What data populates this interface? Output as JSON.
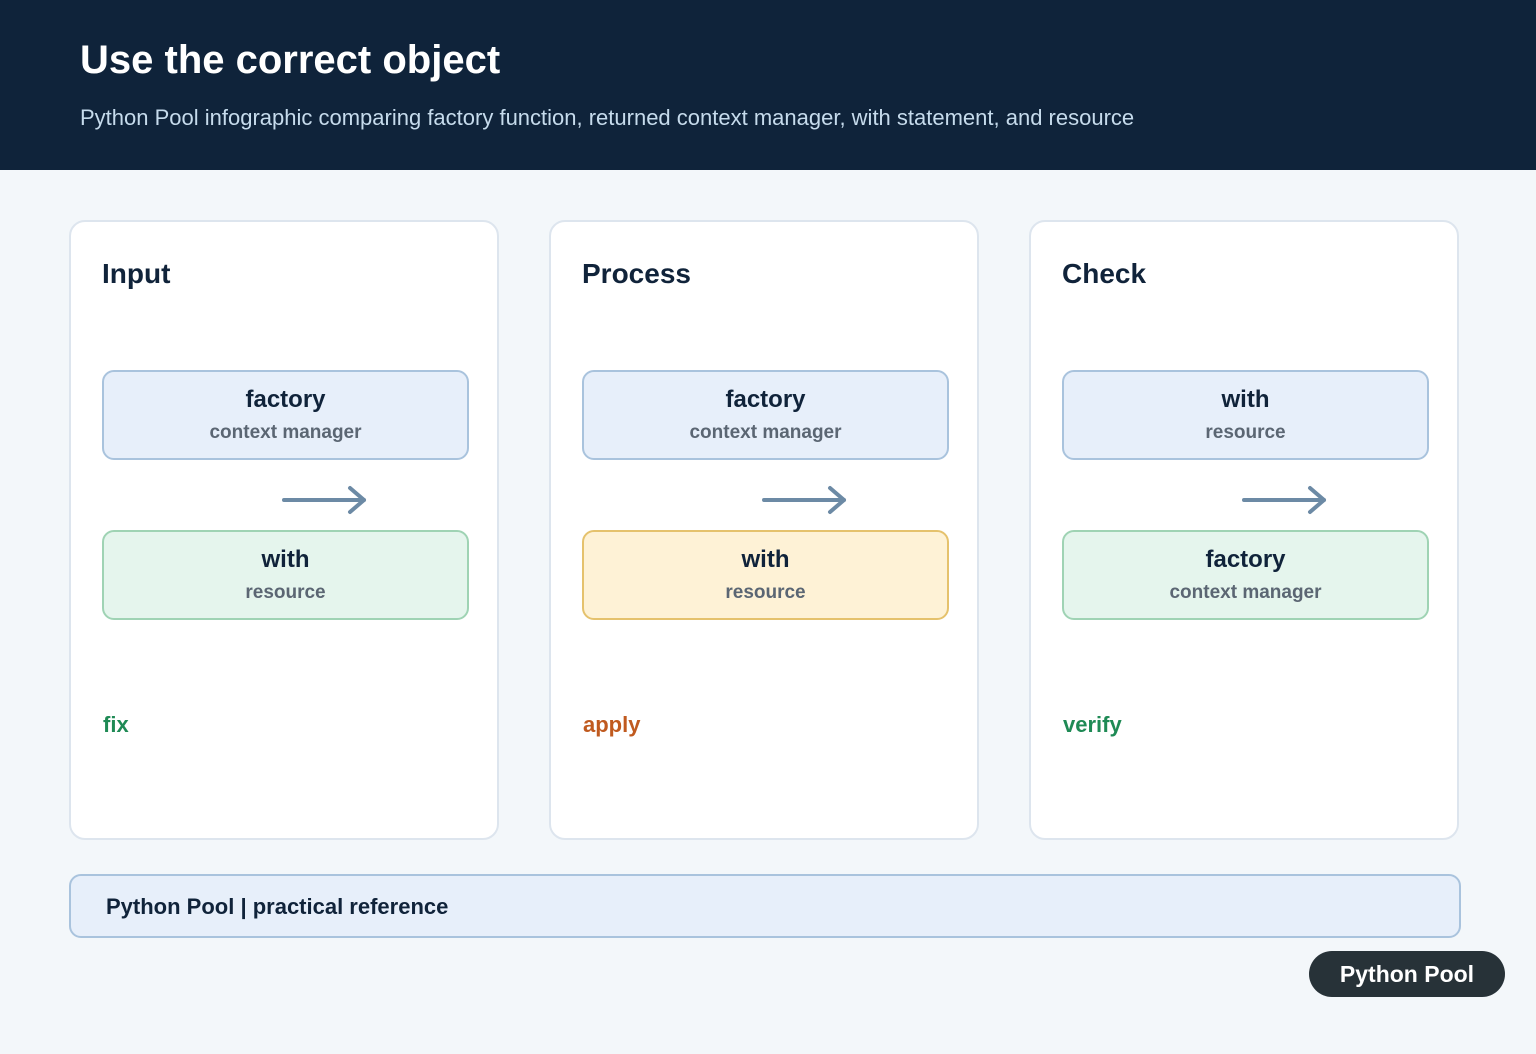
{
  "header": {
    "title": "Use the correct object",
    "subtitle": "Python Pool infographic comparing factory function, returned context manager, with statement, and resource"
  },
  "panels": [
    {
      "title": "Input",
      "top_box": {
        "main": "factory",
        "sub": "context manager"
      },
      "bottom_box": {
        "main": "with",
        "sub": "resource"
      },
      "step": "fix"
    },
    {
      "title": "Process",
      "top_box": {
        "main": "factory",
        "sub": "context manager"
      },
      "bottom_box": {
        "main": "with",
        "sub": "resource"
      },
      "step": "apply"
    },
    {
      "title": "Check",
      "top_box": {
        "main": "with",
        "sub": "resource"
      },
      "bottom_box": {
        "main": "factory",
        "sub": "context manager"
      },
      "step": "verify"
    }
  ],
  "footer": {
    "text": "Python Pool | practical reference"
  },
  "badge": {
    "text": "Python Pool"
  },
  "colors": {
    "header_bg": "#0f233a",
    "arrow": "#6c8aa5",
    "step_green": "#1f8a55",
    "step_orange": "#c05a1f",
    "box_blue": "#e7effa",
    "box_green": "#e5f5ed",
    "box_yellow": "#fef2d6"
  },
  "icons": [
    "arrow-right-icon"
  ]
}
